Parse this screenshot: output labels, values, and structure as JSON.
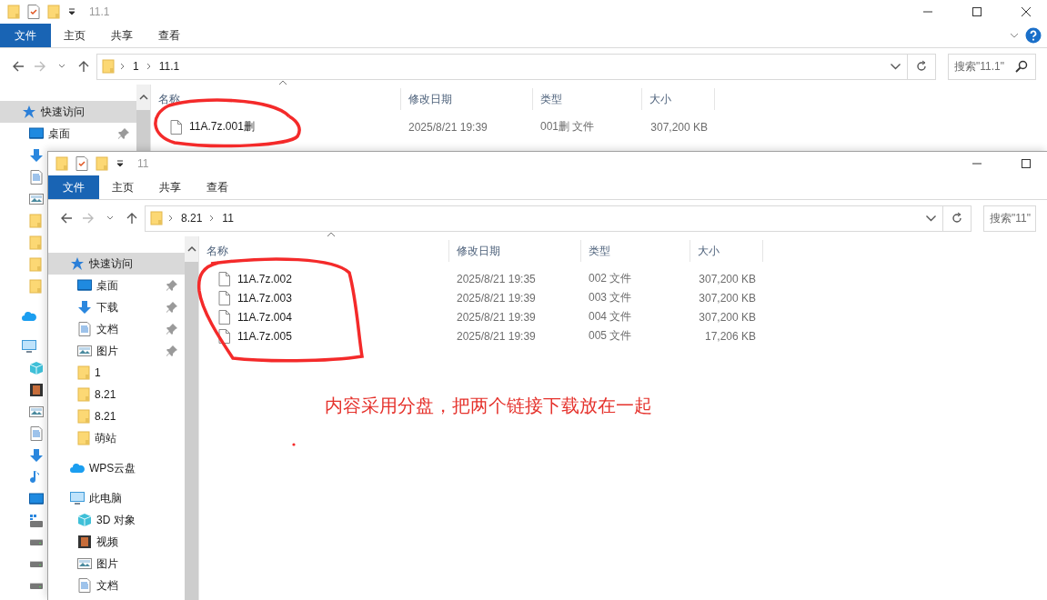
{
  "windows": [
    {
      "title": "11.1",
      "ribbon_tabs": [
        {
          "label": "文件",
          "kind": "menu"
        },
        {
          "label": "主页",
          "kind": "tab"
        },
        {
          "label": "共享",
          "kind": "tab"
        },
        {
          "label": "查看",
          "kind": "tab"
        }
      ],
      "breadcrumb": [
        "1",
        "11.1"
      ],
      "search": {
        "placeholder": "搜索\"11.1\""
      },
      "sidebar": [
        {
          "label": "快速访问",
          "kind": "star",
          "selected": true,
          "children": [
            {
              "label": "桌面",
              "kind": "desktop",
              "pinned": true,
              "selected": false
            },
            {
              "kind": "download"
            },
            {
              "kind": "document"
            },
            {
              "kind": "pictures"
            },
            {
              "kind": "folder"
            },
            {
              "kind": "folder"
            },
            {
              "kind": "folder"
            },
            {
              "kind": "folder"
            }
          ]
        },
        {
          "kind": "cloud"
        },
        {
          "kind": "computer",
          "children": [
            {
              "kind": "cube"
            },
            {
              "kind": "video"
            },
            {
              "kind": "pictures"
            },
            {
              "kind": "document"
            },
            {
              "kind": "download"
            },
            {
              "kind": "music"
            },
            {
              "kind": "desktop"
            },
            {
              "kind": "drive-win"
            },
            {
              "kind": "drive"
            },
            {
              "kind": "drive"
            },
            {
              "kind": "drive"
            }
          ]
        }
      ],
      "columns": [
        "名称",
        "修改日期",
        "类型",
        "大小"
      ],
      "files": [
        {
          "name": "11A.7z.001删",
          "modified": "2025/8/21 19:39",
          "type": "001删 文件",
          "size": "307,200 KB"
        }
      ]
    },
    {
      "title": "11",
      "ribbon_tabs": [
        {
          "label": "文件",
          "kind": "menu"
        },
        {
          "label": "主页",
          "kind": "tab"
        },
        {
          "label": "共享",
          "kind": "tab"
        },
        {
          "label": "查看",
          "kind": "tab"
        }
      ],
      "breadcrumb": [
        "8.21",
        "11"
      ],
      "search": {
        "placeholder": "搜索\"11\""
      },
      "sidebar": [
        {
          "label": "快速访问",
          "kind": "star",
          "selected": true,
          "children": [
            {
              "label": "桌面",
              "kind": "desktop",
              "pinned": true,
              "selected": false
            },
            {
              "label": "下载",
              "kind": "download",
              "pinned": true,
              "selected": false
            },
            {
              "label": "文档",
              "kind": "document",
              "pinned": true,
              "selected": false
            },
            {
              "label": "图片",
              "kind": "pictures",
              "pinned": true,
              "selected": false
            },
            {
              "label": "1",
              "kind": "folder",
              "selected": false
            },
            {
              "label": "8.21",
              "kind": "folder",
              "selected": false
            },
            {
              "label": "8.21",
              "kind": "folder",
              "selected": false
            },
            {
              "label": "萌站",
              "kind": "folder",
              "selected": false
            }
          ]
        },
        {
          "label": "WPS云盘",
          "kind": "cloud",
          "selected": false
        },
        {
          "label": "此电脑",
          "kind": "computer",
          "selected": false,
          "children": [
            {
              "label": "3D 对象",
              "kind": "cube",
              "selected": false
            },
            {
              "label": "视频",
              "kind": "video",
              "selected": false
            },
            {
              "label": "图片",
              "kind": "pictures",
              "selected": false
            },
            {
              "label": "文档",
              "kind": "document",
              "selected": false
            }
          ]
        }
      ],
      "columns": [
        "名称",
        "修改日期",
        "类型",
        "大小"
      ],
      "files": [
        {
          "name": "11A.7z.002",
          "modified": "2025/8/21 19:35",
          "type": "002 文件",
          "size": "307,200 KB"
        },
        {
          "name": "11A.7z.003",
          "modified": "2025/8/21 19:39",
          "type": "003 文件",
          "size": "307,200 KB"
        },
        {
          "name": "11A.7z.004",
          "modified": "2025/8/21 19:39",
          "type": "004 文件",
          "size": "307,200 KB"
        },
        {
          "name": "11A.7z.005",
          "modified": "2025/8/21 19:39",
          "type": "005 文件",
          "size": "17,206 KB"
        }
      ]
    }
  ],
  "annotation": {
    "note": "内容采用分盘，把两个链接下载放在一起"
  }
}
